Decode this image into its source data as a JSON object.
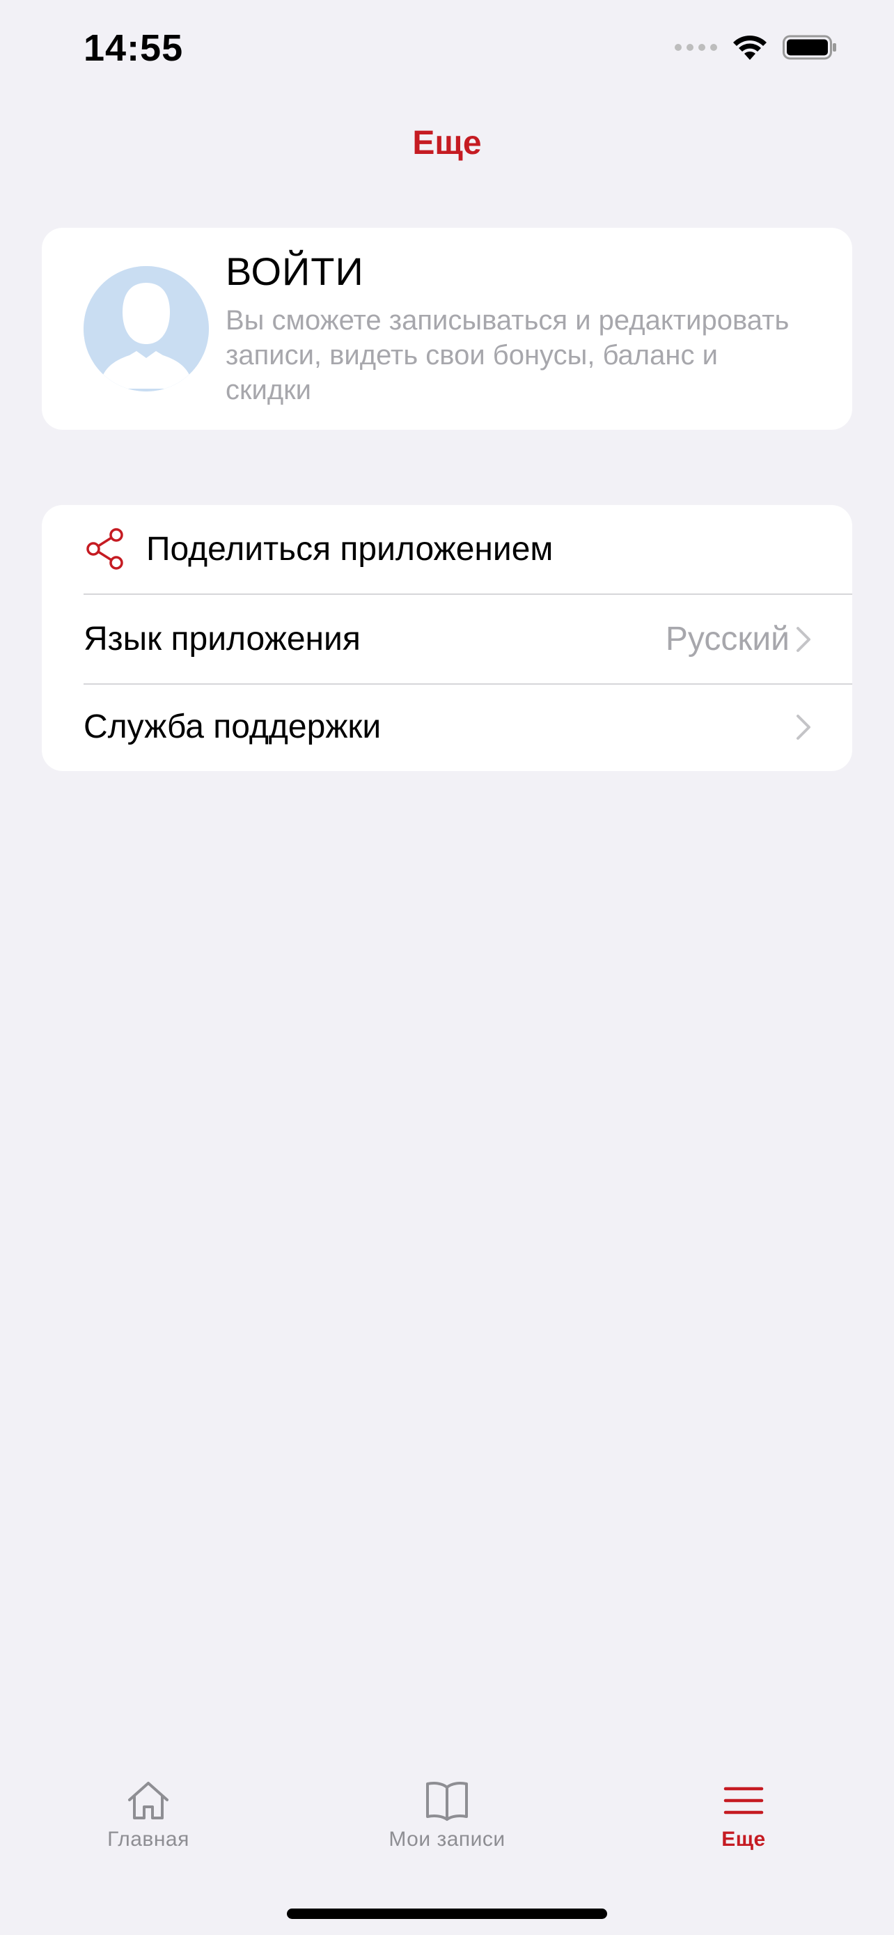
{
  "status_bar": {
    "time": "14:55"
  },
  "header": {
    "title": "Еще",
    "accent_color": "#C51B22"
  },
  "login": {
    "title": "ВОЙТИ",
    "description": "Вы сможете записываться и редактировать записи, видеть свои бонусы, баланс и скидки",
    "avatar_icon": "person-silhouette-icon"
  },
  "menu": {
    "share": {
      "label": "Поделиться приложением",
      "icon": "share-icon"
    },
    "language": {
      "label": "Язык приложения",
      "value": "Русский"
    },
    "support": {
      "label": "Служба поддержки"
    }
  },
  "tabs": [
    {
      "label": "Главная",
      "icon": "home-icon",
      "active": false
    },
    {
      "label": "Мои записи",
      "icon": "book-icon",
      "active": false
    },
    {
      "label": "Еще",
      "icon": "menu-icon",
      "active": true
    }
  ]
}
